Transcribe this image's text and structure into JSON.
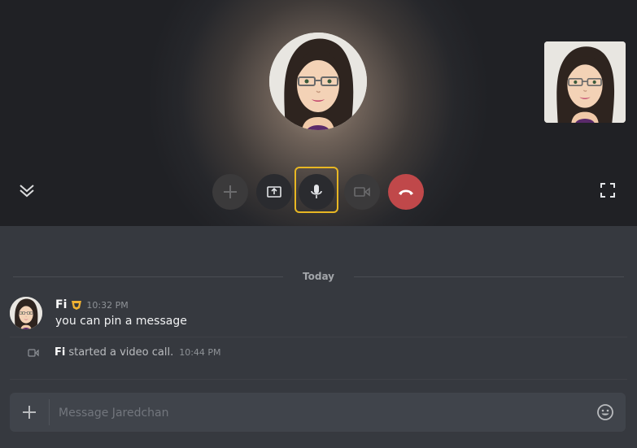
{
  "call": {
    "remote_avatar": "cartoon-woman-avatar",
    "self_view": "cartoon-woman-avatar",
    "controls": [
      {
        "name": "add-button",
        "icon": "plus-icon",
        "state": "disabled"
      },
      {
        "name": "screen-share-button",
        "icon": "screen-share-icon",
        "state": "enabled"
      },
      {
        "name": "microphone-button",
        "icon": "microphone-icon",
        "state": "focused"
      },
      {
        "name": "camera-button",
        "icon": "video-camera-icon",
        "state": "disabled"
      },
      {
        "name": "end-call-button",
        "icon": "phone-hangup-icon",
        "state": "danger"
      }
    ],
    "collapse_icon": "chevrons-down-icon",
    "fullscreen_icon": "fullscreen-icon",
    "colors": {
      "end_call": "#c0484a",
      "focus_ring": "#e8b723"
    }
  },
  "chat": {
    "divider_label": "Today",
    "messages": [
      {
        "author": "Fi",
        "badge": "hypesquad-badge-icon",
        "timestamp": "10:32 PM",
        "text": "you can pin a message"
      }
    ],
    "system_message": {
      "icon": "video-camera-icon",
      "author": "Fi",
      "text": "started a video call.",
      "timestamp": "10:44 PM"
    }
  },
  "composer": {
    "placeholder": "Message Jaredchan",
    "value": "",
    "attach_icon": "plus-icon",
    "emoji_icon": "emoji-smile-icon"
  }
}
